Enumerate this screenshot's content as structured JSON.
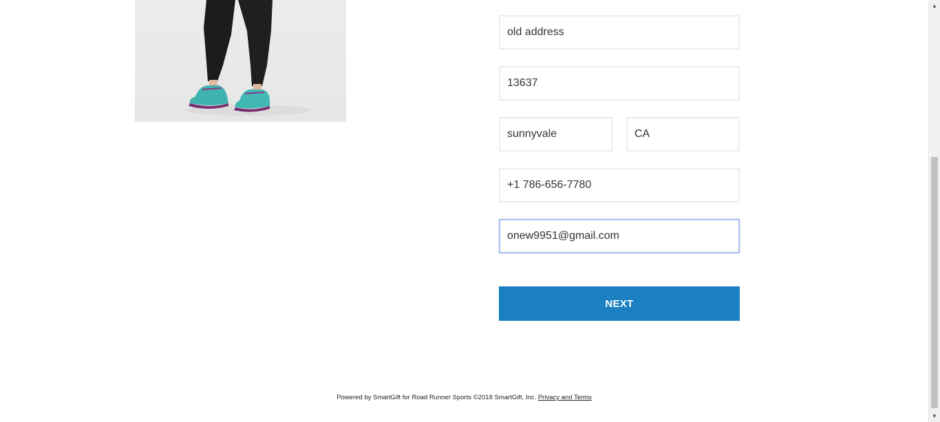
{
  "form": {
    "address": "old address",
    "zip": "13637",
    "city": "sunnyvale",
    "state": "CA",
    "phone": "+1 786-656-7780",
    "email": "onew9951@gmail.com"
  },
  "next_button": {
    "label": "NEXT",
    "color": "#1a80c2"
  },
  "footer": {
    "text": "Powered by SmartGift for Road Runner Sports ©2018 SmartGift, Inc.",
    "link": "Privacy and Terms"
  },
  "scrollbar": {
    "up_icon": "arrow-up-icon",
    "down_icon": "arrow-down-icon"
  },
  "colors": {
    "focus_border": "#a9c1ee",
    "field_border": "#ececec"
  }
}
